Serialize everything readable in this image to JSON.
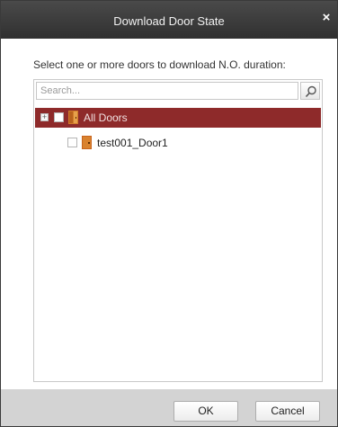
{
  "dialog": {
    "title": "Download Door State",
    "close_symbol": "×",
    "instruction": "Select one or more doors to download N.O. duration:"
  },
  "search": {
    "placeholder": "Search...",
    "value": ""
  },
  "tree": {
    "items": [
      {
        "label": "All Doors",
        "icon": "door-group-icon",
        "selected": true,
        "expandable": true,
        "expander_symbol": "+"
      },
      {
        "label": "test001_Door1",
        "icon": "door-icon",
        "selected": false,
        "expandable": false
      }
    ]
  },
  "buttons": {
    "ok": "OK",
    "cancel": "Cancel"
  },
  "colors": {
    "titlebar": "#3a3a3a",
    "selected_row": "#8e2a2a",
    "footer": "#d3d3d3",
    "door": "#c8651e"
  }
}
